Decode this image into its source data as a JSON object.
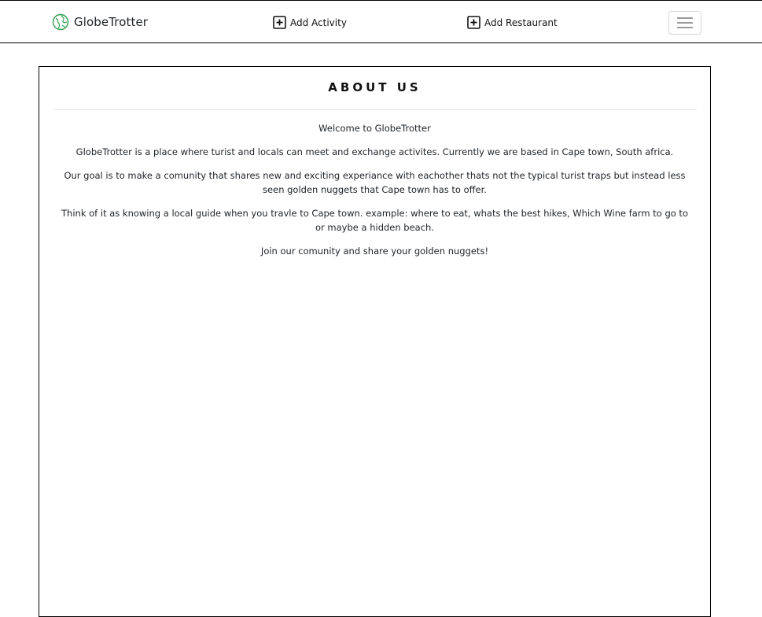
{
  "navbar": {
    "brand": "GlobeTrotter",
    "brand_icon": "globe-icon",
    "brand_color": "#2e9e4f",
    "links": [
      {
        "label": "Add Activity",
        "icon": "plus-square-icon"
      },
      {
        "label": "Add Restaurant",
        "icon": "plus-square-icon"
      }
    ],
    "toggler_icon": "hamburger-menu-icon"
  },
  "about": {
    "title": "ABOUT US",
    "paragraphs": [
      "Welcome to GlobeTrotter",
      "GlobeTrotter is a place where turist and locals can meet and exchange activites. Currently we are based in Cape town, South africa.",
      "Our goal is to make a comunity that shares new and exciting experiance with eachother thats not the typical turist traps but instead less seen golden nuggets that Cape town has to offer.",
      "Think of it as knowing a local guide when you travle to Cape town. example: where to eat, whats the best hikes, Which Wine farm to go to or maybe a hidden beach.",
      "Join our comunity and share your golden nuggets!"
    ]
  }
}
